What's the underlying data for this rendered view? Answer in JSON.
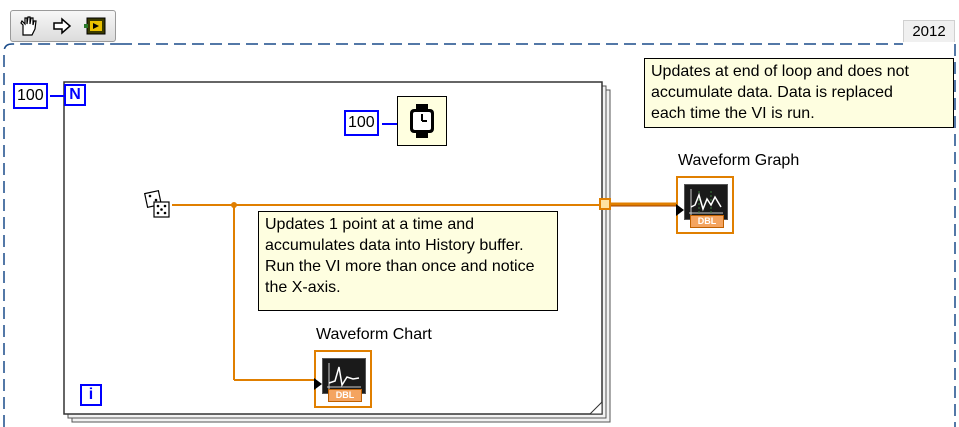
{
  "toolbar": {
    "tools": [
      {
        "icon": "hand-operate-icon"
      },
      {
        "icon": "arrow-right-icon"
      },
      {
        "icon": "probe-icon"
      }
    ]
  },
  "version_tag": "2012",
  "diagram": {
    "outer_count": "100",
    "for_loop": {
      "count_terminal": "N",
      "iteration_terminal": "i"
    },
    "wait_constant": "100",
    "notes": {
      "graph_note": "Updates at end of loop and does not\naccumulate data. Data is replaced\neach time the VI is run.",
      "chart_note": "Updates 1 point at a time and\naccumulates data into History buffer.\nRun the VI more than once and notice\nthe X-axis."
    },
    "indicators": {
      "graph_label": "Waveform Graph",
      "chart_label": "Waveform Chart",
      "dtype": "DBL"
    },
    "colors": {
      "wire": "#e07f00",
      "terminal_blue": "#0000ff",
      "note_bg": "#fefee0"
    }
  }
}
